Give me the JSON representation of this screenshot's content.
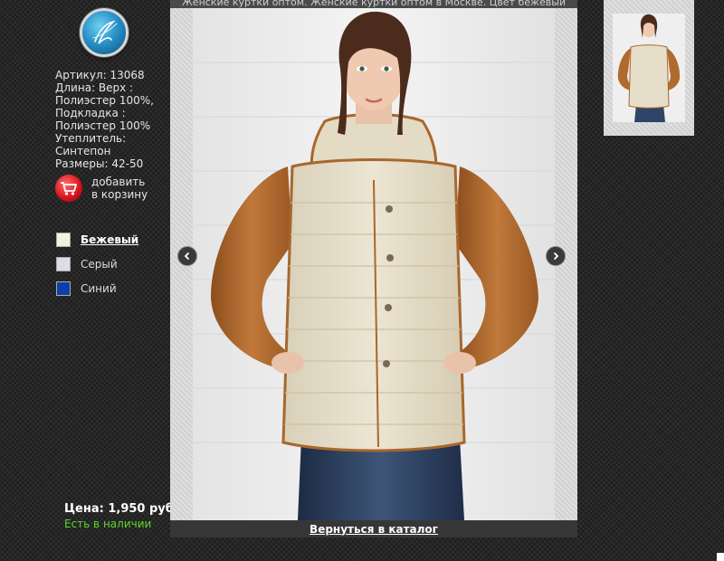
{
  "product": {
    "title_line": "Женские куртки оптом. Женские куртки оптом в Москве. Цвет бежевый",
    "details": [
      "Артикул: 13068",
      "Длина: Верх :",
      "Полиэстер 100%,",
      "Подкладка :",
      "Полиэстер 100%",
      "Утеплитель:",
      "Синтепон",
      "Размеры: 42-50"
    ],
    "price": "Цена: 1,950 руб.",
    "availability": "Есть в наличии"
  },
  "cart": {
    "line1": "добавить",
    "line2": "в корзину",
    "icon": "cart-icon"
  },
  "colors": [
    {
      "label": "Бежевый",
      "swatch": "#f6f3d9",
      "selected": true
    },
    {
      "label": "Серый",
      "swatch": "#dcdce8",
      "selected": false
    },
    {
      "label": "Синий",
      "swatch": "#0d3fa8",
      "selected": false
    }
  ],
  "gallery": {
    "back_link": "Вернуться в каталог",
    "prev_icon": "chevron-left-icon",
    "next_icon": "chevron-right-icon"
  },
  "theme": {
    "background": "#262626",
    "stock_green": "#5fd62b",
    "cart_red": "#d3121a",
    "logo_blue": "#2a93c9"
  }
}
